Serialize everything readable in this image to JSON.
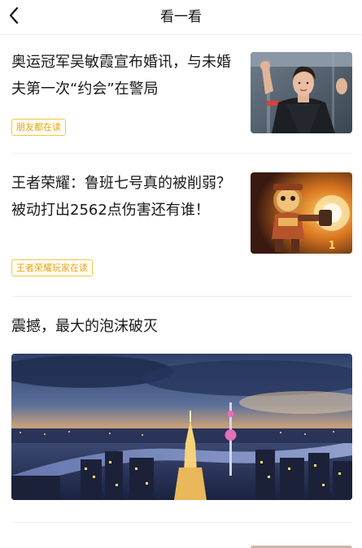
{
  "header": {
    "title": "看一看"
  },
  "feed": [
    {
      "title": "奥运冠军吴敏霞宣布婚讯，与未婚夫第一次“约会”在警局",
      "tag": "朋友都在读",
      "thumb": "diver-athlete-photo"
    },
    {
      "title": "王者荣耀：鲁班七号真的被削弱？被动打出2562点伤害还有谁！",
      "tag": "王者荣耀玩家在读",
      "thumb": "game-character-art"
    },
    {
      "title": "震撼，最大的泡沫破灭",
      "image": "city-skyline-night-photo"
    }
  ],
  "colors": {
    "accent_tag_border": "#f2c744",
    "accent_tag_text": "#e3a51a",
    "divider": "#ededed"
  }
}
